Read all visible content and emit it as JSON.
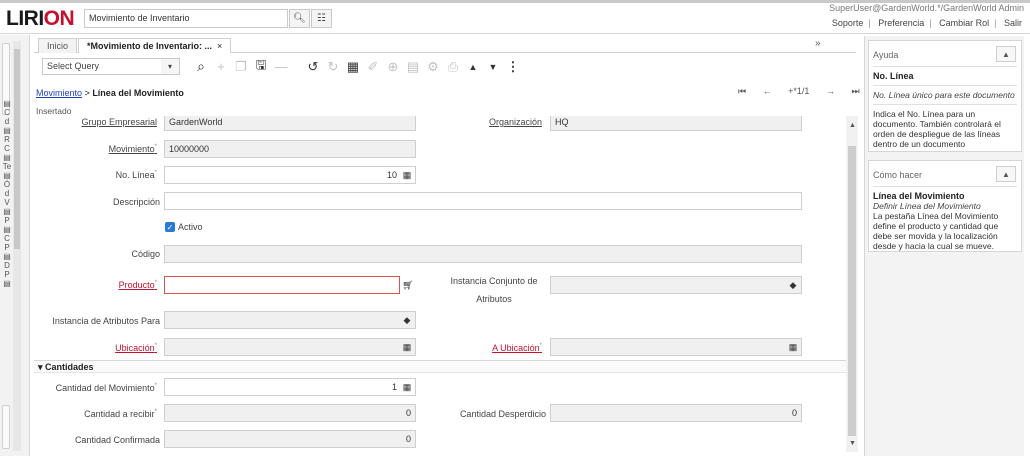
{
  "app": {
    "logo_prefix": "LIRI",
    "logo_suffix": "ON",
    "menu_search_value": "Movimiento de Inventario",
    "user": "SuperUser@GardenWorld.*/GardenWorld Admin",
    "links": [
      "Soporte",
      "Preferencia",
      "Cambiar Rol",
      "Salir"
    ]
  },
  "tabs": [
    {
      "label": "Inicio"
    },
    {
      "label": "*Movimiento de Inventario: ...",
      "close": "×"
    }
  ],
  "toolbar": {
    "query_placeholder": "Select Query",
    "icons": [
      "search-icon",
      "new-icon",
      "copy-icon",
      "save-icon",
      "delete-icon",
      "undo-icon",
      "refresh-icon",
      "grid-toggle-icon",
      "attachment-icon",
      "zoom-icon",
      "report-icon",
      "settings-icon",
      "print-icon",
      "previous-icon",
      "next-icon",
      "more-icon"
    ]
  },
  "breadcrumb": {
    "parent": "Movimiento",
    "sep": ">",
    "current": "Línea del Movimiento"
  },
  "nav": {
    "record": "+*1/1"
  },
  "status": "Insertado",
  "form": {
    "grupo_label": "Grupo Empresarial",
    "grupo_value": "GardenWorld",
    "org_label": "Organización",
    "org_value": "HQ",
    "movimiento_label": "Movimiento",
    "movimiento_value": "10000000",
    "linea_label": "No. Línea",
    "linea_value": "10",
    "descripcion_label": "Descripción",
    "descripcion_value": "",
    "activo_label": "Activo",
    "codigo_label": "Código",
    "codigo_value": "",
    "producto_label": "Producto",
    "producto_value": "",
    "instancia_label_1": "Instancia Conjunto de",
    "instancia_label_2": "Atributos",
    "instancia_para_label": "Instancia de Atributos Para",
    "ubicacion_label": "Ubicación",
    "a_ubicacion_label": "A Ubicación",
    "cantidades_section": "Cantidades",
    "cantidad_mov_label": "Cantidad del Movimiento",
    "cantidad_mov_value": "1",
    "cantidad_recibir_label": "Cantidad a recibir",
    "cantidad_recibir_value": "0",
    "cantidad_desperdicio_label": "Cantidad Desperdicio",
    "cantidad_desperdicio_value": "0",
    "cantidad_confirmada_label": "Cantidad Confirmada",
    "cantidad_confirmada_value": "0"
  },
  "help": {
    "ayuda_header": "Ayuda",
    "ayuda_title": "No. Línea",
    "ayuda_italic": "No. Línea único para este documento",
    "ayuda_text": "Indica el No. Línea para un documento. También controlará el orden de despliegue de las líneas dentro de un documento",
    "como_header": "Cómo hacer",
    "como_title": "Línea del Movimiento",
    "como_italic": "Definir Línea del Movimiento",
    "como_text": "La pestaña Línea del Movimiento define el producto y cantidad que debe ser movida y la localización desde y hacia la cual se mueve."
  }
}
